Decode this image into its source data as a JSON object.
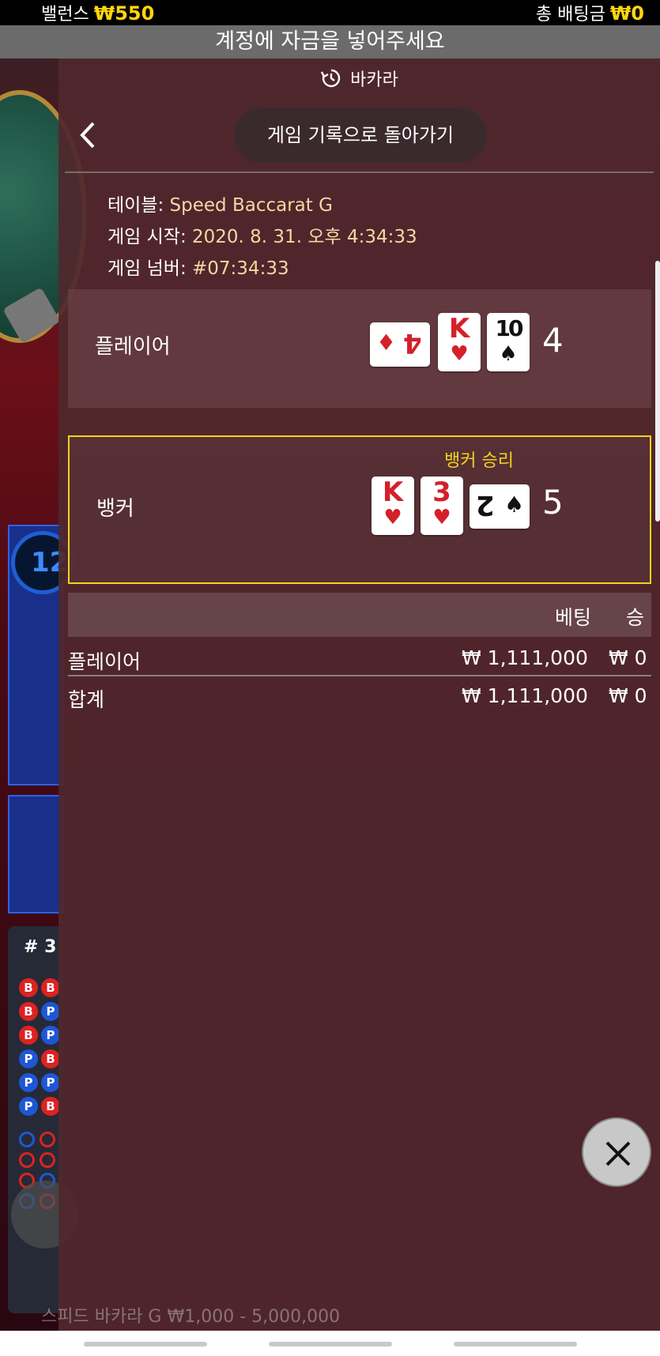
{
  "status": {
    "balance_label": "밸런스",
    "balance_value": "₩550",
    "total_bet_label": "총 배팅금",
    "total_bet_value": "₩0"
  },
  "deposit_banner": "계정에 자금을 넣어주세요",
  "header": {
    "title": "바카라",
    "icon": "history-icon"
  },
  "nav": {
    "back_icon": "chevron-left-icon",
    "history_button": "게임 기록으로 돌아가기"
  },
  "game_info": {
    "table_label": "테이블:",
    "table_value": "Speed Baccarat G",
    "start_label": "게임 시작:",
    "start_value": "2020. 8. 31. 오후 4:34:33",
    "number_label": "게임 넘버:",
    "number_value": "#07:34:33"
  },
  "player": {
    "label": "플레이어",
    "score": "4",
    "cards": [
      {
        "rank": "4",
        "suit": "♦",
        "color": "#d4202a",
        "orientation": "sideways"
      },
      {
        "rank": "K",
        "suit": "♥",
        "color": "#d4202a",
        "orientation": "upright"
      },
      {
        "rank": "10",
        "suit": "♠",
        "color": "#111111",
        "orientation": "upright"
      }
    ]
  },
  "banker": {
    "label": "뱅커",
    "win_label": "뱅커 승리",
    "score": "5",
    "cards": [
      {
        "rank": "K",
        "suit": "♥",
        "color": "#d4202a",
        "orientation": "upright"
      },
      {
        "rank": "3",
        "suit": "♥",
        "color": "#d4202a",
        "orientation": "upright"
      },
      {
        "rank": "2",
        "suit": "♠",
        "color": "#111111",
        "orientation": "sideways"
      }
    ]
  },
  "bets_table": {
    "columns": [
      "베팅",
      "승"
    ],
    "rows": [
      {
        "name": "플레이어",
        "bet": "₩ 1,111,000",
        "win": "₩ 0"
      },
      {
        "name": "합계",
        "bet": "₩ 1,111,000",
        "win": "₩ 0"
      }
    ]
  },
  "background": {
    "timer": "12",
    "road_label": "# 3",
    "footer": "스피드 바카라 G ₩1,000 - 5,000,000",
    "bead_road": [
      "B",
      "B",
      "B",
      "P",
      "B",
      "P",
      "P",
      "B",
      "P",
      "P",
      "P",
      "B"
    ]
  },
  "close_icon": "close-icon",
  "colors": {
    "accent": "#ffd60a",
    "win_border": "#f2d21c",
    "red_suit": "#d4202a"
  }
}
